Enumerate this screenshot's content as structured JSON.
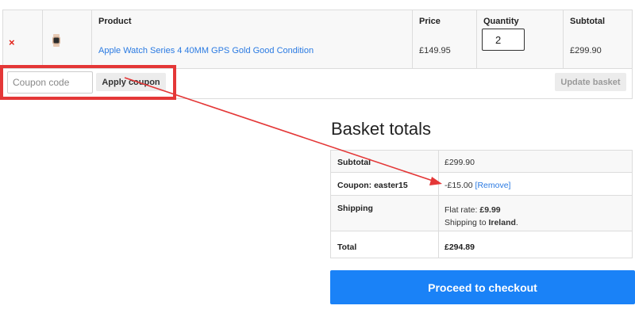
{
  "cart": {
    "headers": {
      "product": "Product",
      "price": "Price",
      "quantity": "Quantity",
      "subtotal": "Subtotal"
    },
    "item": {
      "remove_symbol": "×",
      "product_name": "Apple Watch Series 4 40MM GPS Gold Good Condition",
      "price": "£149.95",
      "quantity": "2",
      "subtotal": "£299.90"
    },
    "coupon_placeholder": "Coupon code",
    "apply_coupon_label": "Apply coupon",
    "update_basket_label": "Update basket"
  },
  "totals": {
    "title": "Basket totals",
    "subtotal_label": "Subtotal",
    "subtotal_value": "£299.90",
    "coupon_label": "Coupon: easter15",
    "coupon_value": "-£15.00",
    "coupon_remove": "[Remove]",
    "shipping_label": "Shipping",
    "shipping_rate_prefix": "Flat rate: ",
    "shipping_rate_value": "£9.99",
    "shipping_to_prefix": "Shipping to ",
    "shipping_country": "Ireland",
    "shipping_to_suffix": ".",
    "total_label": "Total",
    "total_value": "£294.89"
  },
  "checkout_label": "Proceed to checkout",
  "colors": {
    "annotation": "#e43737",
    "link": "#2a7ae2",
    "checkout_bg": "#1a82f7",
    "remove": "#e2231a"
  }
}
